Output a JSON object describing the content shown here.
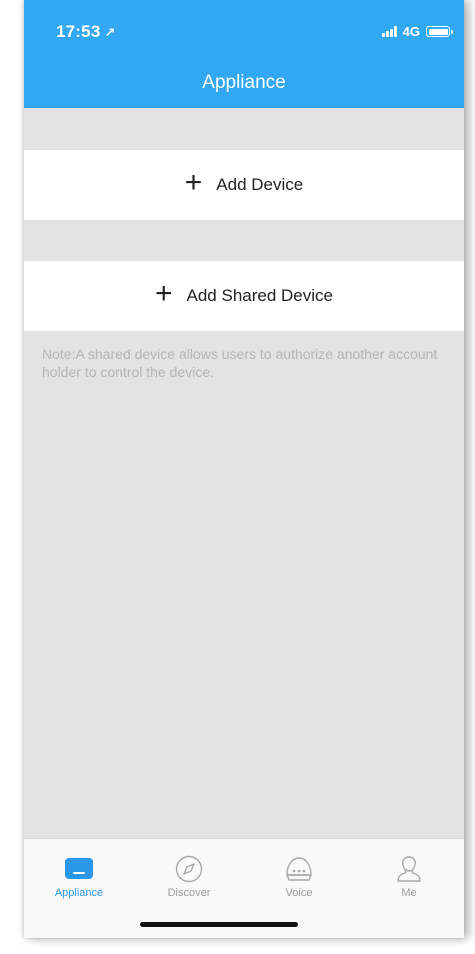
{
  "status_bar": {
    "time": "17:53",
    "location_glyph": "↗",
    "network": "4G"
  },
  "header": {
    "title": "Appliance"
  },
  "actions": {
    "add_device_label": "Add Device",
    "add_shared_device_label": "Add Shared Device",
    "plus_glyph": "+"
  },
  "note": "Note:A shared device allows users to authorize another account holder to control the device.",
  "tabbar": {
    "tabs": [
      {
        "label": "Appliance",
        "icon": "appliance-icon",
        "active": true
      },
      {
        "label": "Discover",
        "icon": "compass-icon",
        "active": false
      },
      {
        "label": "Voice",
        "icon": "voice-icon",
        "active": false
      },
      {
        "label": "Me",
        "icon": "person-icon",
        "active": false
      }
    ]
  },
  "colors": {
    "header_bg": "#32a8f5",
    "page_bg": "#e3e3e3",
    "active_tab": "#2b97e8",
    "inactive_tab": "#9a9a9a",
    "note_text": "#b5b5b5"
  }
}
